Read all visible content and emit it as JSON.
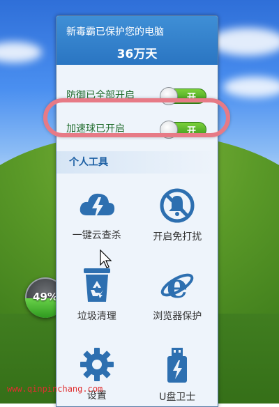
{
  "panel": {
    "header_line1": "新毒霸已保护您的电脑",
    "header_line2": "36万天",
    "toggles": [
      {
        "label": "防御已全部开启",
        "state": "开"
      },
      {
        "label": "加速球已开启",
        "state": "开"
      }
    ],
    "section_title": "个人工具",
    "tools": [
      {
        "label": "一键云查杀",
        "icon": "cloud-lightning-icon"
      },
      {
        "label": "开启免打扰",
        "icon": "do-not-disturb-bell-icon"
      },
      {
        "label": "垃圾清理",
        "icon": "recycle-bin-icon"
      },
      {
        "label": "浏览器保护",
        "icon": "ie-browser-icon"
      },
      {
        "label": "设置",
        "icon": "gear-icon"
      },
      {
        "label": "U盘卫士",
        "icon": "usb-drive-icon"
      }
    ]
  },
  "accelerator_ball": {
    "percent_text": "49%",
    "fill": 0.49
  },
  "watermark": "www.qinpinchang.com",
  "colors": {
    "header_blue": "#2a75c2",
    "switch_green": "#4caf27",
    "highlight_ring": "#e77a86"
  }
}
